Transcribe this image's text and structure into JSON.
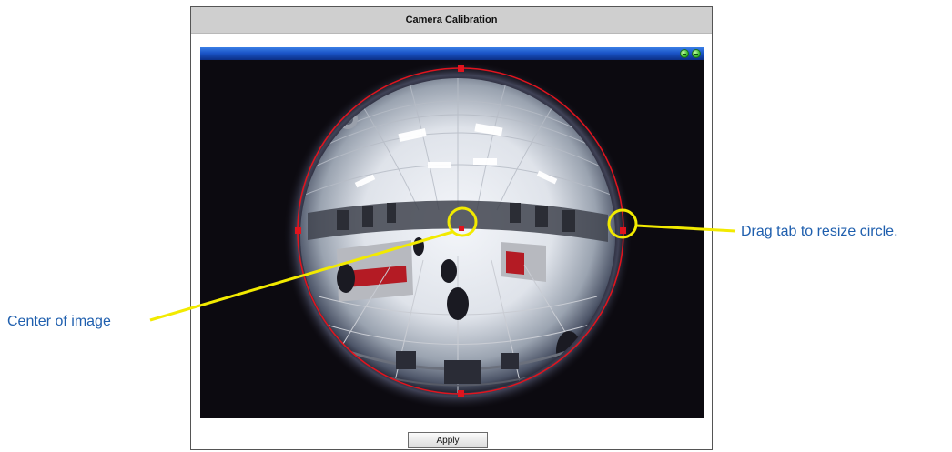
{
  "dialog": {
    "title": "Camera Calibration",
    "apply_label": "Apply"
  },
  "annotations": {
    "resize_note": "Drag tab to resize circle.",
    "center_note": "Center of image"
  },
  "colors": {
    "title_bar": "#cfcfcf",
    "viewer_bar": "#1b55c8",
    "calibration_circle": "#e0141e",
    "callout_marker": "#f2ea00",
    "callout_text": "#1f5fae"
  },
  "icons": {
    "viewer_controls": [
      "minimize-icon",
      "minimize-icon"
    ]
  }
}
